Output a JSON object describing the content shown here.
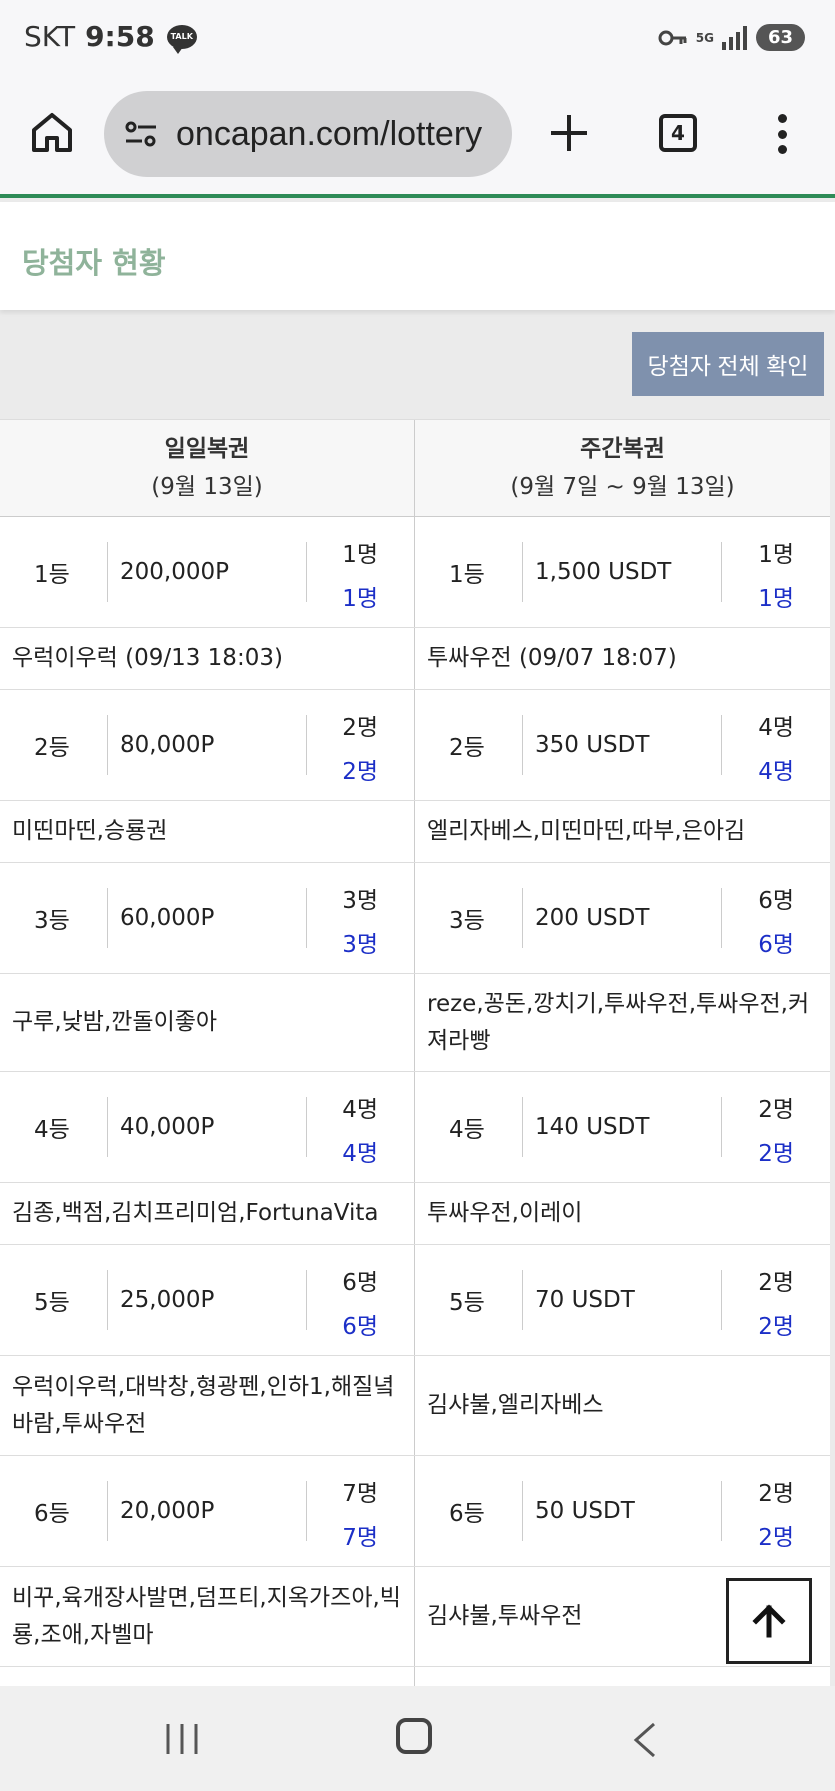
{
  "status": {
    "carrier": "SKT",
    "time": "9:58",
    "talk": "TALK",
    "network": "5G",
    "battery": "63"
  },
  "browser": {
    "url": "oncapan.com/lottery",
    "tab_count": "4"
  },
  "page": {
    "title": "당첨자 현황",
    "all_winners_button": "당첨자 전체 확인"
  },
  "table": {
    "headers": [
      {
        "title": "일일복권",
        "period": "(9월 13일)"
      },
      {
        "title": "주간복권",
        "period": "(9월 7일 ~ 9월 13일)"
      }
    ],
    "rows": [
      {
        "daily": {
          "rank": "1등",
          "prize": "200,000P",
          "total": "1명",
          "won": "1명",
          "winners": "우럭이우럭 (09/13 18:03)"
        },
        "weekly": {
          "rank": "1등",
          "prize": "1,500 USDT",
          "total": "1명",
          "won": "1명",
          "winners": "투싸우전 (09/07 18:07)"
        }
      },
      {
        "daily": {
          "rank": "2등",
          "prize": "80,000P",
          "total": "2명",
          "won": "2명",
          "winners": "미띤마띤,승룡권"
        },
        "weekly": {
          "rank": "2등",
          "prize": "350 USDT",
          "total": "4명",
          "won": "4명",
          "winners": "엘리자베스,미띤마띤,따부,은아김"
        }
      },
      {
        "daily": {
          "rank": "3등",
          "prize": "60,000P",
          "total": "3명",
          "won": "3명",
          "winners": "구루,낮밤,깐돌이좋아"
        },
        "weekly": {
          "rank": "3등",
          "prize": "200 USDT",
          "total": "6명",
          "won": "6명",
          "winners": "reze,꽁돈,깡치기,투싸우전,투싸우전,커져라빵"
        }
      },
      {
        "daily": {
          "rank": "4등",
          "prize": "40,000P",
          "total": "4명",
          "won": "4명",
          "winners": "김종,백점,김치프리미엄,FortunaVita"
        },
        "weekly": {
          "rank": "4등",
          "prize": "140 USDT",
          "total": "2명",
          "won": "2명",
          "winners": "투싸우전,이레이"
        }
      },
      {
        "daily": {
          "rank": "5등",
          "prize": "25,000P",
          "total": "6명",
          "won": "6명",
          "winners": "우럭이우럭,대박창,형광펜,인하1,해질녘바람,투싸우전"
        },
        "weekly": {
          "rank": "5등",
          "prize": "70 USDT",
          "total": "2명",
          "won": "2명",
          "winners": "김샤불,엘리자베스"
        }
      },
      {
        "daily": {
          "rank": "6등",
          "prize": "20,000P",
          "total": "7명",
          "won": "7명",
          "winners": "비꾸,육개장사발면,덤프티,지옥가즈아,빅룡,조애,자벨마"
        },
        "weekly": {
          "rank": "6등",
          "prize": "50 USDT",
          "total": "2명",
          "won": "2명",
          "winners": "김샤불,투싸우전"
        }
      }
    ]
  },
  "icons": {
    "home": "home-icon",
    "tune": "site-settings-icon",
    "plus": "new-tab-icon",
    "menu": "more-vert-icon",
    "up": "arrow-up-icon"
  },
  "colors": {
    "accent_green": "#2e8b57",
    "title_green": "#8fb39a",
    "button_blue": "#7f91ad",
    "count_blue": "#1c2fc7"
  }
}
